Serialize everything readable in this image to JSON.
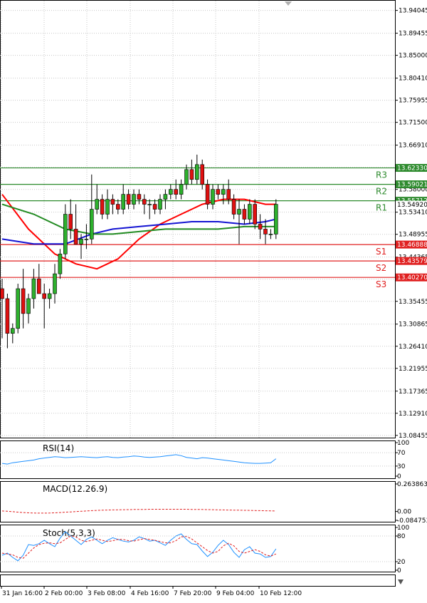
{
  "chart_data": {
    "type": "candlestick",
    "price_axis": {
      "ticks": [
        "13.94045",
        "13.89455",
        "13.85000",
        "13.80410",
        "13.75955",
        "13.71500",
        "13.66910",
        "13.62455",
        "13.58000",
        "13.53410",
        "13.48955",
        "13.44365",
        "13.39910",
        "13.35455",
        "13.30865",
        "13.26410",
        "13.21955",
        "13.17365",
        "13.12910",
        "13.08455"
      ],
      "ylim": [
        13.08,
        13.96
      ]
    },
    "current_price": "13.54920",
    "levels": [
      {
        "name": "R3",
        "value": 13.6233,
        "label": "13.62330",
        "color": "#2e8b2e"
      },
      {
        "name": "R2",
        "value": 13.59021,
        "label": "13.59021",
        "color": "#2e8b2e"
      },
      {
        "name": "R1",
        "value": 13.55712,
        "label": "13.55712",
        "color": "#2e8b2e"
      },
      {
        "name": "S1",
        "value": 13.46888,
        "label": "13.46888",
        "color": "#e02020"
      },
      {
        "name": "S2",
        "value": 13.43579,
        "label": "13.43579",
        "color": "#e02020"
      },
      {
        "name": "S3",
        "value": 13.4027,
        "label": "13.40270",
        "color": "#e02020"
      }
    ],
    "time_labels": [
      "31 Jan 16:00",
      "2 Feb 00:00",
      "3 Feb 08:00",
      "4 Feb 16:00",
      "7 Feb 20:00",
      "9 Feb 04:00",
      "10 Feb 12:00"
    ],
    "candles": [
      [
        13.38,
        13.4,
        13.28,
        13.36
      ],
      [
        13.36,
        13.37,
        13.26,
        13.29
      ],
      [
        13.29,
        13.31,
        13.27,
        13.3
      ],
      [
        13.3,
        13.39,
        13.29,
        13.38
      ],
      [
        13.38,
        13.42,
        13.3,
        13.33
      ],
      [
        13.33,
        13.37,
        13.31,
        13.36
      ],
      [
        13.36,
        13.42,
        13.34,
        13.4
      ],
      [
        13.4,
        13.43,
        13.37,
        13.37
      ],
      [
        13.37,
        13.39,
        13.3,
        13.36
      ],
      [
        13.36,
        13.38,
        13.34,
        13.37
      ],
      [
        13.37,
        13.43,
        13.35,
        13.41
      ],
      [
        13.41,
        13.46,
        13.4,
        13.45
      ],
      [
        13.45,
        13.55,
        13.44,
        13.53
      ],
      [
        13.53,
        13.56,
        13.48,
        13.5
      ],
      [
        13.5,
        13.55,
        13.47,
        13.47
      ],
      [
        13.47,
        13.49,
        13.44,
        13.48
      ],
      [
        13.48,
        13.51,
        13.46,
        13.48
      ],
      [
        13.48,
        13.61,
        13.47,
        13.54
      ],
      [
        13.54,
        13.59,
        13.53,
        13.56
      ],
      [
        13.56,
        13.57,
        13.52,
        13.53
      ],
      [
        13.53,
        13.58,
        13.52,
        13.56
      ],
      [
        13.56,
        13.57,
        13.53,
        13.55
      ],
      [
        13.55,
        13.56,
        13.53,
        13.54
      ],
      [
        13.54,
        13.59,
        13.53,
        13.57
      ],
      [
        13.57,
        13.58,
        13.54,
        13.55
      ],
      [
        13.55,
        13.58,
        13.54,
        13.57
      ],
      [
        13.57,
        13.58,
        13.55,
        13.56
      ],
      [
        13.56,
        13.57,
        13.53,
        13.55
      ],
      [
        13.55,
        13.56,
        13.52,
        13.55
      ],
      [
        13.55,
        13.56,
        13.53,
        13.54
      ],
      [
        13.54,
        13.57,
        13.53,
        13.56
      ],
      [
        13.56,
        13.58,
        13.54,
        13.57
      ],
      [
        13.57,
        13.59,
        13.56,
        13.58
      ],
      [
        13.58,
        13.6,
        13.56,
        13.57
      ],
      [
        13.57,
        13.6,
        13.56,
        13.59
      ],
      [
        13.59,
        13.63,
        13.58,
        13.62
      ],
      [
        13.62,
        13.64,
        13.59,
        13.6
      ],
      [
        13.6,
        13.65,
        13.59,
        13.63
      ],
      [
        13.63,
        13.64,
        13.58,
        13.59
      ],
      [
        13.59,
        13.6,
        13.54,
        13.55
      ],
      [
        13.55,
        13.59,
        13.54,
        13.58
      ],
      [
        13.58,
        13.59,
        13.56,
        13.57
      ],
      [
        13.57,
        13.59,
        13.55,
        13.58
      ],
      [
        13.58,
        13.6,
        13.55,
        13.56
      ],
      [
        13.56,
        13.57,
        13.52,
        13.53
      ],
      [
        13.53,
        13.56,
        13.47,
        13.54
      ],
      [
        13.54,
        13.55,
        13.51,
        13.52
      ],
      [
        13.52,
        13.56,
        13.51,
        13.55
      ],
      [
        13.55,
        13.56,
        13.5,
        13.51
      ],
      [
        13.51,
        13.53,
        13.48,
        13.5
      ],
      [
        13.5,
        13.52,
        13.47,
        13.49
      ],
      [
        13.49,
        13.5,
        13.48,
        13.49
      ],
      [
        13.49,
        13.56,
        13.48,
        13.55
      ]
    ],
    "moving_averages": [
      {
        "color": "#ff0000",
        "points": [
          [
            0,
            13.57
          ],
          [
            5,
            13.5
          ],
          [
            10,
            13.45
          ],
          [
            14,
            13.43
          ],
          [
            18,
            13.42
          ],
          [
            22,
            13.44
          ],
          [
            26,
            13.48
          ],
          [
            30,
            13.51
          ],
          [
            34,
            13.53
          ],
          [
            38,
            13.55
          ],
          [
            42,
            13.56
          ],
          [
            46,
            13.56
          ],
          [
            50,
            13.55
          ],
          [
            52,
            13.55
          ]
        ]
      },
      {
        "color": "#1414d2",
        "points": [
          [
            0,
            13.48
          ],
          [
            6,
            13.47
          ],
          [
            12,
            13.47
          ],
          [
            17,
            13.49
          ],
          [
            21,
            13.5
          ],
          [
            26,
            13.505
          ],
          [
            31,
            13.51
          ],
          [
            36,
            13.515
          ],
          [
            41,
            13.515
          ],
          [
            46,
            13.51
          ],
          [
            50,
            13.515
          ],
          [
            52,
            13.52
          ]
        ]
      },
      {
        "color": "#228b22",
        "points": [
          [
            0,
            13.55
          ],
          [
            6,
            13.53
          ],
          [
            12,
            13.5
          ],
          [
            17,
            13.49
          ],
          [
            21,
            13.49
          ],
          [
            26,
            13.495
          ],
          [
            31,
            13.5
          ],
          [
            36,
            13.5
          ],
          [
            41,
            13.5
          ],
          [
            46,
            13.505
          ],
          [
            50,
            13.505
          ],
          [
            52,
            13.505
          ]
        ]
      }
    ],
    "rsi": {
      "title": "RSI(14)",
      "ticks": [
        "100",
        "70",
        "30",
        "0"
      ],
      "ylim": [
        0,
        100
      ],
      "values": [
        38,
        36,
        40,
        42,
        44,
        46,
        48,
        52,
        54,
        56,
        58,
        57,
        55,
        56,
        57,
        58,
        57,
        56,
        55,
        57,
        58,
        56,
        55,
        57,
        58,
        60,
        59,
        57,
        56,
        57,
        58,
        60,
        62,
        64,
        61,
        56,
        54,
        52,
        55,
        54,
        52,
        50,
        48,
        46,
        44,
        42,
        40,
        39,
        38,
        38,
        39,
        40,
        52
      ]
    },
    "macd": {
      "title": "MACD(12.26.9)",
      "ticks": [
        "0.263863",
        "0.00",
        "-0.084753"
      ],
      "ylim": [
        -0.084753,
        0.263863
      ],
      "signal": [
        0.005,
        0.002,
        -0.002,
        -0.006,
        -0.01,
        -0.013,
        -0.015,
        -0.016,
        -0.016,
        -0.015,
        -0.013,
        -0.01,
        -0.007,
        -0.004,
        -0.001,
        0.002,
        0.005,
        0.008,
        0.01,
        0.012,
        0.014,
        0.015,
        0.016,
        0.017,
        0.018,
        0.019,
        0.02,
        0.02,
        0.021,
        0.021,
        0.021,
        0.021,
        0.021,
        0.021,
        0.021,
        0.021,
        0.02,
        0.02,
        0.019,
        0.018,
        0.017,
        0.016,
        0.015,
        0.014,
        0.013,
        0.012,
        0.011,
        0.01,
        0.009,
        0.008,
        0.007,
        0.006,
        0.005
      ]
    },
    "stoch": {
      "title": "Stoch(5,3,3)",
      "ticks": [
        "100",
        "80",
        "20",
        "0"
      ],
      "ylim": [
        0,
        100
      ],
      "main": [
        35,
        40,
        30,
        22,
        35,
        60,
        58,
        62,
        70,
        62,
        55,
        75,
        90,
        80,
        70,
        60,
        72,
        78,
        70,
        62,
        70,
        76,
        72,
        68,
        66,
        70,
        78,
        74,
        68,
        70,
        64,
        58,
        70,
        80,
        85,
        72,
        62,
        60,
        45,
        32,
        42,
        58,
        70,
        60,
        42,
        30,
        48,
        55,
        40,
        38,
        30,
        32,
        50
      ],
      "signal": [
        40,
        38,
        36,
        30,
        28,
        40,
        52,
        60,
        63,
        64,
        62,
        64,
        72,
        80,
        78,
        70,
        67,
        70,
        73,
        70,
        67,
        69,
        72,
        72,
        69,
        68,
        71,
        74,
        72,
        70,
        67,
        64,
        64,
        69,
        78,
        79,
        73,
        64,
        55,
        46,
        40,
        44,
        57,
        63,
        57,
        44,
        40,
        44,
        48,
        44,
        36,
        33,
        38
      ]
    },
    "xlabel": "",
    "ylabel": ""
  }
}
